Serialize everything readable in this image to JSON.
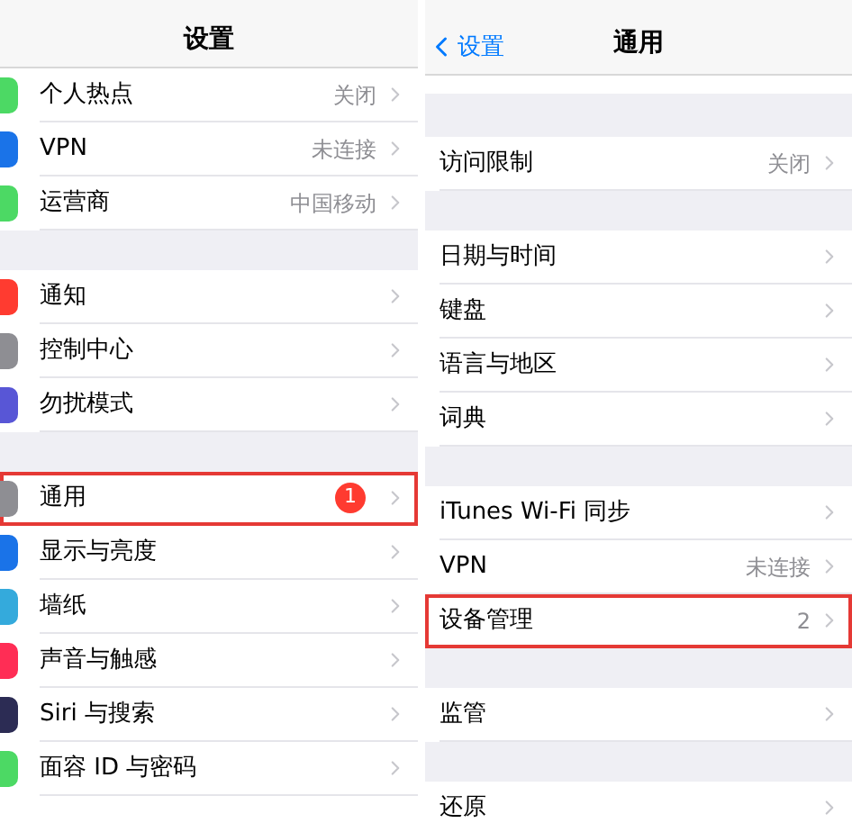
{
  "left_panel": {
    "title": "设置",
    "sections": [
      [
        {
          "label": "个人热点",
          "value": "关闭",
          "color": "#4cd964",
          "highlighted": false
        },
        {
          "label": "VPN",
          "value": "未连接",
          "color": "#1a73e8",
          "highlighted": false
        },
        {
          "label": "运营商",
          "value": "中国移动",
          "color": "#4cd964",
          "highlighted": false
        }
      ],
      [
        {
          "label": "通知",
          "color": "#ff3b30",
          "highlighted": false
        },
        {
          "label": "控制中心",
          "color": "#8e8e93",
          "highlighted": false
        },
        {
          "label": "勿扰模式",
          "color": "#5856d6",
          "highlighted": false
        }
      ],
      [
        {
          "label": "通用",
          "badge": "1",
          "color": "#8e8e93",
          "highlighted": true
        },
        {
          "label": "显示与亮度",
          "color": "#1a73e8",
          "highlighted": false
        },
        {
          "label": "墙纸",
          "color": "#34aadc",
          "highlighted": false
        },
        {
          "label": "声音与触感",
          "color": "#ff2d55",
          "highlighted": false
        },
        {
          "label": "Siri 与搜索",
          "color": "#2c2c54",
          "highlighted": false
        },
        {
          "label": "面容 ID 与密码",
          "color": "#4cd964",
          "highlighted": false
        }
      ]
    ]
  },
  "right_panel": {
    "back_label": "设置",
    "title": "通用",
    "sections": [
      [
        {
          "label": "访问限制",
          "value": "关闭",
          "highlighted": false
        }
      ],
      [
        {
          "label": "日期与时间",
          "highlighted": false
        },
        {
          "label": "键盘",
          "highlighted": false
        },
        {
          "label": "语言与地区",
          "highlighted": false
        },
        {
          "label": "词典",
          "highlighted": false
        }
      ],
      [
        {
          "label": "iTunes Wi-Fi 同步",
          "highlighted": false
        },
        {
          "label": "VPN",
          "value": "未连接",
          "highlighted": false
        },
        {
          "label": "设备管理",
          "value": "2",
          "highlighted": true
        }
      ],
      [
        {
          "label": "监管",
          "highlighted": false
        }
      ],
      [
        {
          "label": "还原",
          "highlighted": false
        }
      ]
    ]
  }
}
